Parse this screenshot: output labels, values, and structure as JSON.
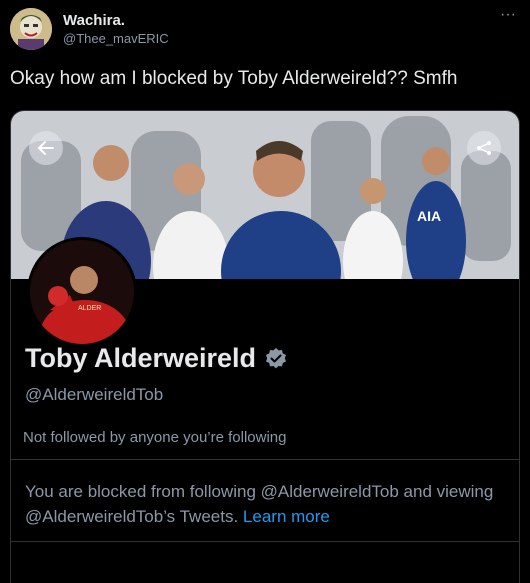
{
  "tweet": {
    "author_name": "Wachira.",
    "author_handle": "@Thee_mavERIC",
    "text": "Okay how am I blocked by Toby Alderweireld?? Smfh",
    "more_icon": "more-horizontal-icon"
  },
  "profile": {
    "name": "Toby Alderweireld",
    "handle": "@AlderweireldTob",
    "followed_by": "Not followed by anyone you’re following",
    "blocked_message": "You are blocked from following @AlderweireldTob and viewing @AlderweireldTob’s Tweets.",
    "learn_more": "Learn more",
    "banner_shirt_text": "AIA",
    "verified_icon": "verified-badge-icon"
  },
  "colors": {
    "background": "#000000",
    "text_primary": "#e7e9ea",
    "text_secondary": "#8b98a5",
    "link": "#1d9bf0",
    "border": "#2f3336"
  }
}
